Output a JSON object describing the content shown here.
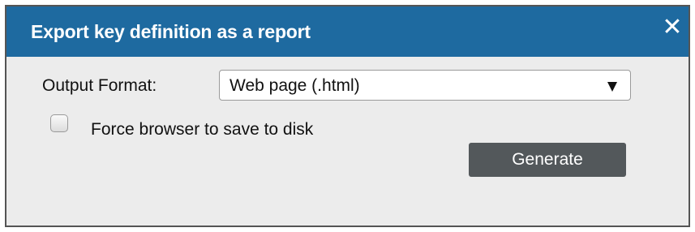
{
  "dialog": {
    "title": "Export key definition as a report",
    "close_icon": "close-icon",
    "close_glyph": "✕"
  },
  "form": {
    "output_format_label": "Output Format:",
    "output_format_value": "Web page (.html)",
    "force_save_label": "Force browser to save to disk",
    "force_save_checked": false,
    "generate_label": "Generate"
  },
  "colors": {
    "titlebar": "#1e6aa0",
    "background": "#ececec",
    "button": "#53585b"
  }
}
